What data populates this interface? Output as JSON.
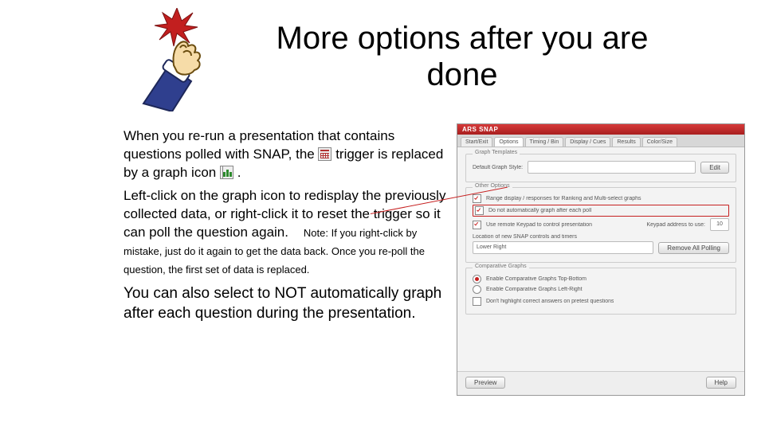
{
  "title": "More options after you are done",
  "body": {
    "p1a": "When you re-run a presentation that contains questions polled with SNAP, the ",
    "p1b": " trigger is replaced by a graph icon ",
    "p1c": " .",
    "p2": "Left-click on the graph icon to redisplay the previously collected data, or right-click it to reset the trigger so it can poll the question again.",
    "note": "Note:  If you right-click by mistake, just do it again to get the data back.  Once you re-poll the question, the first set of data is replaced.",
    "p3": "You can also select to NOT automatically graph after each question during the presentation."
  },
  "panel": {
    "titlebar": "ARS SNAP",
    "tabs": [
      "Start/Exit",
      "Options",
      "Timing / Bin",
      "Display / Cues",
      "Results",
      "Color/Size"
    ],
    "group1": {
      "legend": "Graph Templates",
      "combo_label": "Default Graph Style:",
      "edit_btn": "Edit"
    },
    "group2": {
      "legend": "Other Options",
      "opt1": "Range display / responses for Ranking and Multi-select graphs",
      "opt2": "Do not automatically graph after each poll",
      "opt3": "Use remote Keypad to control presentation",
      "opt3_field_label": "Keypad address to use:",
      "opt3_val": "10",
      "loc_label": "Location of new SNAP controls and timers",
      "loc_combo": "Lower Right",
      "remove_btn": "Remove All Polling"
    },
    "group3": {
      "legend": "Comparative Graphs",
      "r1": "Enable Comparative Graphs Top-Bottom",
      "r2": "Enable Comparative Graphs Left-Right",
      "c1": "Don't highlight correct answers on pretest questions"
    },
    "footer": {
      "preview": "Preview",
      "help": "Help"
    }
  }
}
